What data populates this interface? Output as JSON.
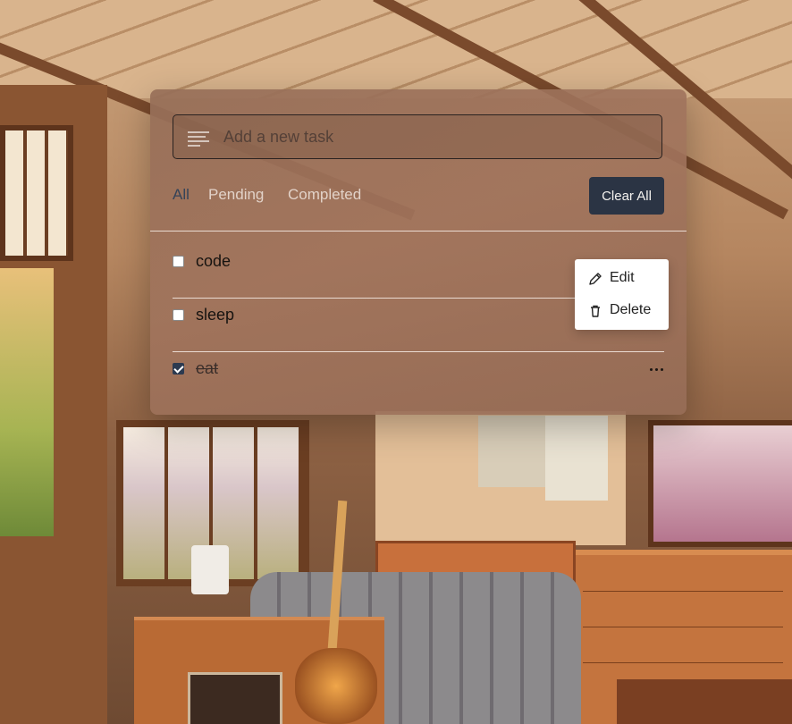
{
  "input": {
    "placeholder": "Add a new task",
    "value": ""
  },
  "filters": [
    {
      "label": "All",
      "active": true
    },
    {
      "label": "Pending",
      "active": false
    },
    {
      "label": "Completed",
      "active": false
    }
  ],
  "clear_all_label": "Clear All",
  "tasks": [
    {
      "label": "code",
      "done": false
    },
    {
      "label": "sleep",
      "done": false
    },
    {
      "label": "eat",
      "done": true
    }
  ],
  "task_menu": {
    "items": [
      {
        "label": "Edit",
        "icon": "pencil-icon"
      },
      {
        "label": "Delete",
        "icon": "trash-icon"
      }
    ]
  },
  "colors": {
    "accent": "#2b3444",
    "active_filter": "#354358"
  }
}
